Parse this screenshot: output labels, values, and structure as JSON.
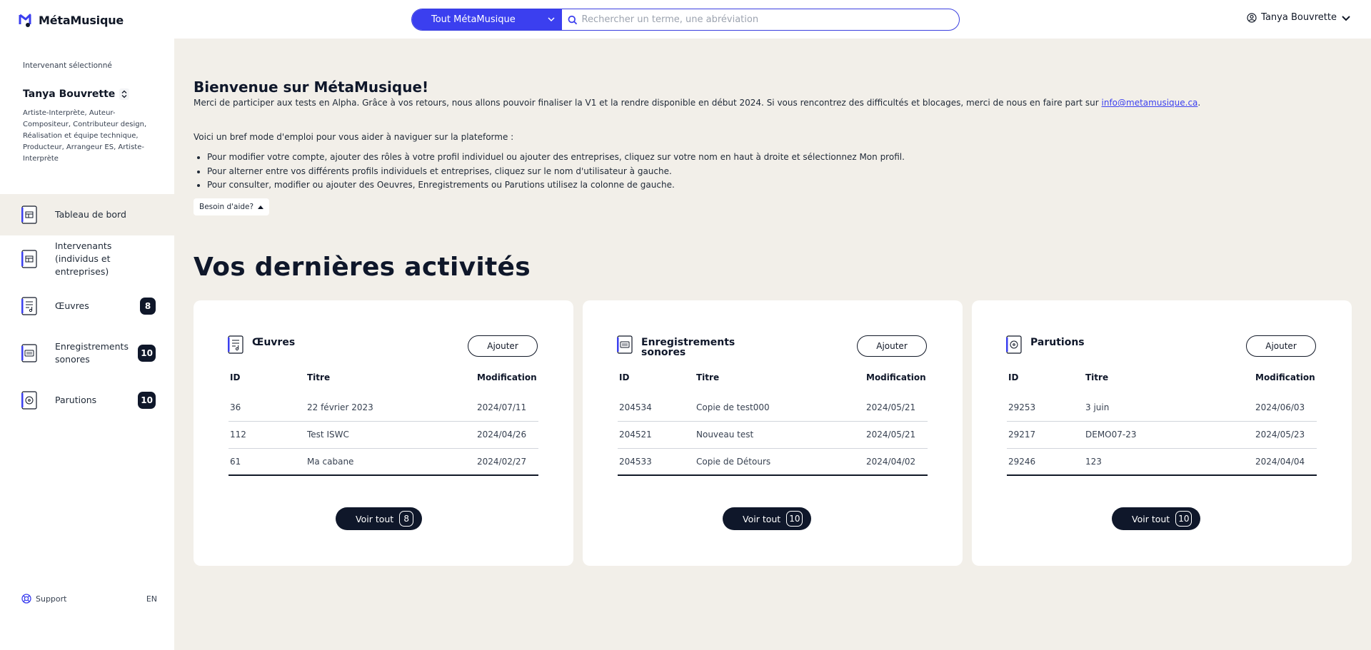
{
  "app": {
    "name": "MétaMusique"
  },
  "colors": {
    "accent": "#3b3fef",
    "dark": "#0f172a",
    "background": "#f2efe9"
  },
  "search": {
    "scope_label": "Tout MétaMusique",
    "placeholder": "Rechercher un terme, une abréviation",
    "value": ""
  },
  "user_menu": {
    "name": "Tanya Bouvrette"
  },
  "sidebar": {
    "selected_label": "Intervenant sélectionné",
    "user_name": "Tanya Bouvrette",
    "roles": "Artiste-Interprète, Auteur-Compositeur, Contributeur design, Réalisation et équipe technique, Producteur, Arrangeur ES, Artiste-Interprète",
    "nav": [
      {
        "label": "Tableau de bord",
        "icon": "dashboard-icon",
        "badge": ""
      },
      {
        "label": "Intervenants (individus et entreprises)",
        "icon": "contributors-icon",
        "badge": ""
      },
      {
        "label": "Œuvres",
        "icon": "works-icon",
        "badge": "8"
      },
      {
        "label": "Enregistrements sonores",
        "icon": "recordings-icon",
        "badge": "10"
      },
      {
        "label": "Parutions",
        "icon": "releases-icon",
        "badge": "10"
      }
    ],
    "support_label": "Support",
    "lang_label": "EN"
  },
  "welcome": {
    "title": "Bienvenue sur MétaMusique!",
    "text": "Merci de participer aux tests en Alpha. Grâce à vos retours, nous allons pouvoir finaliser la V1 et la rendre disponible en début 2024.  Si vous rencontrez des difficultés et blocages, merci de nous en faire part sur ",
    "email": "info@metamusique.ca",
    "text_end": ".",
    "guide_intro": "Voici un bref mode d'emploi pour vous aider à naviguer sur la plateforme :",
    "guide_items": [
      "Pour modifier votre compte, ajouter des rôles à votre profil individuel ou ajouter des entreprises, cliquez sur votre nom en haut à droite et sélectionnez Mon profil.",
      "Pour alterner entre vos différents profils individuels et entreprises, cliquez sur le nom d'utilisateur à gauche.",
      "Pour consulter, modifier ou ajouter des Oeuvres, Enregistrements ou Parutions utilisez la colonne de gauche."
    ],
    "help_label": "Besoin d'aide?"
  },
  "activities": {
    "title": "Vos dernières activités",
    "cards": [
      {
        "title": "Œuvres",
        "icon": "works-icon",
        "add_label": "Ajouter",
        "headers": [
          "ID",
          "Titre",
          "Modification"
        ],
        "rows": [
          [
            "36",
            "22 février 2023",
            "2024/07/11"
          ],
          [
            "112",
            "Test ISWC",
            "2024/04/26"
          ],
          [
            "61",
            "Ma cabane",
            "2024/02/27"
          ]
        ],
        "view_all_label": "Voir tout",
        "count": "8"
      },
      {
        "title": "Enregistrements sonores",
        "icon": "recordings-icon",
        "add_label": "Ajouter",
        "headers": [
          "ID",
          "Titre",
          "Modification"
        ],
        "rows": [
          [
            "204534",
            "Copie de test000",
            "2024/05/21"
          ],
          [
            "204521",
            "Nouveau test",
            "2024/05/21"
          ],
          [
            "204533",
            "Copie de Détours",
            "2024/04/02"
          ]
        ],
        "view_all_label": "Voir tout",
        "count": "10"
      },
      {
        "title": "Parutions",
        "icon": "releases-icon",
        "add_label": "Ajouter",
        "headers": [
          "ID",
          "Titre",
          "Modification"
        ],
        "rows": [
          [
            "29253",
            "3 juin",
            "2024/06/03"
          ],
          [
            "29217",
            "DEMO07-23",
            "2024/05/23"
          ],
          [
            "29246",
            "123",
            "2024/04/04"
          ]
        ],
        "view_all_label": "Voir tout",
        "count": "10"
      }
    ]
  }
}
